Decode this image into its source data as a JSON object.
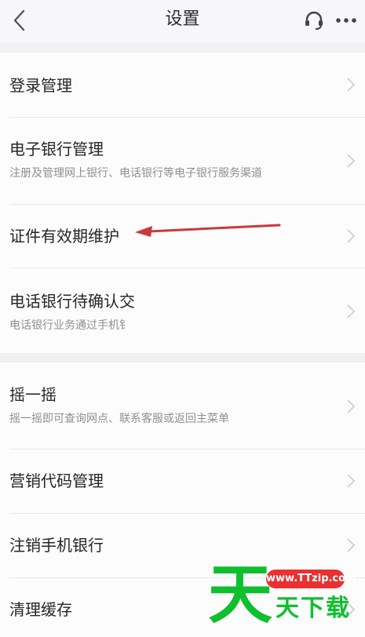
{
  "header": {
    "title": "设置",
    "back_icon": "chevron-left-icon",
    "headset_icon": "headset-icon",
    "more_icon": "more-dots-icon"
  },
  "section1": {
    "rows": [
      {
        "label": "登录管理"
      },
      {
        "label": "电子银行管理",
        "sub": "注册及管理网上银行、电话银行等电子银行服务渠道"
      },
      {
        "label": "证件有效期维护"
      },
      {
        "label": "电话银行待确认交",
        "sub": "电话银行业务通过手机钅"
      }
    ]
  },
  "section2": {
    "rows": [
      {
        "label": "摇一摇",
        "sub": "摇一摇即可查询网点、联系客服或返回主菜单"
      },
      {
        "label": "营销代码管理"
      },
      {
        "label": "注销手机银行"
      },
      {
        "label": "清理缓存"
      }
    ]
  },
  "annotation": {
    "arrow_color": "#c9393c"
  },
  "watermark": {
    "big_char": "天",
    "url": "www.TTzip.com",
    "text": "天下载"
  },
  "colors": {
    "background": "#f2f0f2",
    "card": "#fdfcfd",
    "watermark_green": "#0fbf2e",
    "watermark_red": "#ea3030"
  }
}
